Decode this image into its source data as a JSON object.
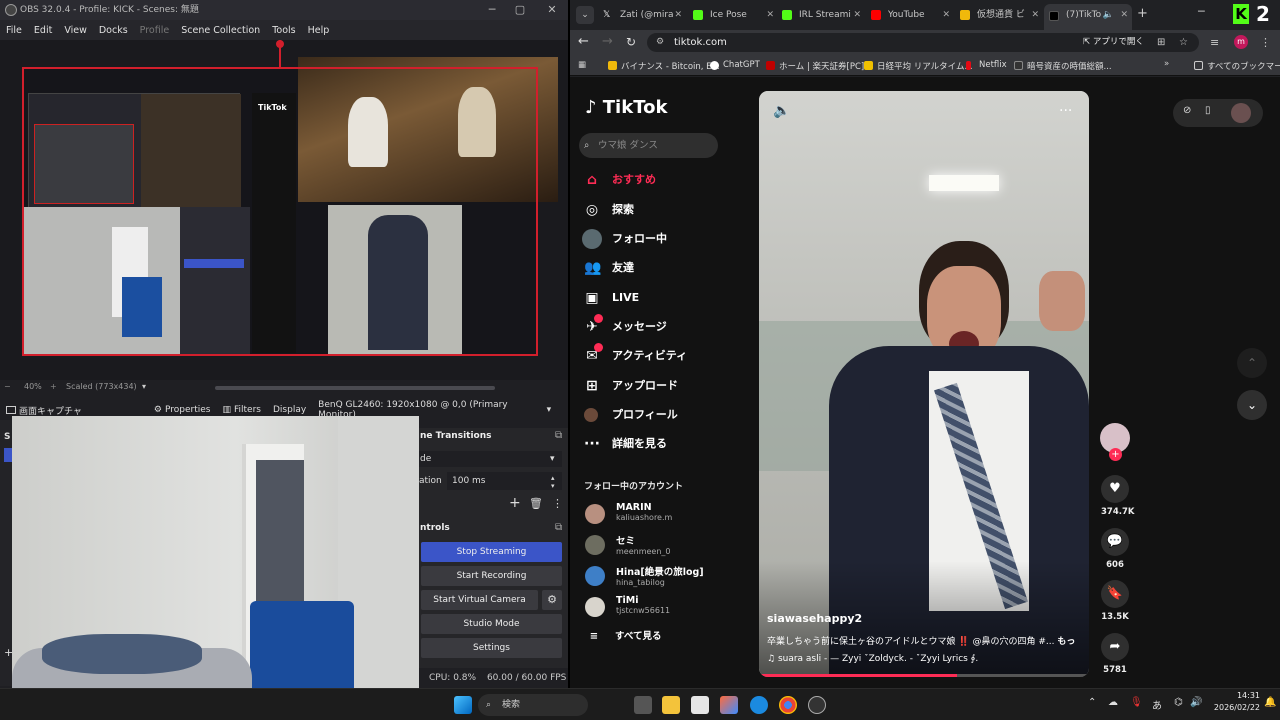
{
  "obs": {
    "title": "OBS 32.0.4 - Profile: KICK - Scenes: 無題",
    "menu": [
      "File",
      "Edit",
      "View",
      "Docks",
      "Profile",
      "Scene Collection",
      "Tools",
      "Help"
    ],
    "zoom": "40%",
    "scaled": "Scaled (773x434)",
    "source_name": "画面キャプチャ",
    "properties_label": "Properties",
    "filters_label": "Filters",
    "display_label": "Display",
    "display_value": "BenQ GL2460: 1920x1080 @ 0,0 (Primary Monitor)",
    "transitions_header": "ne Transitions",
    "transition_type": "de",
    "duration_label": "ation",
    "duration_value": "100 ms",
    "controls_header": "ntrols",
    "buttons": {
      "stop_streaming": "Stop Streaming",
      "start_recording": "Start Recording",
      "start_virtual_camera": "Start Virtual Camera",
      "studio_mode": "Studio Mode",
      "settings": "Settings"
    },
    "status": {
      "cpu": "CPU: 0.8%",
      "fps": "60.00 / 60.00 FPS"
    }
  },
  "chrome": {
    "tabs": [
      {
        "label": "Zati (@mira",
        "color": "#000000"
      },
      {
        "label": "Ice Pose",
        "color": "#53fc18"
      },
      {
        "label": "IRL Streami",
        "color": "#53fc18"
      },
      {
        "label": "YouTube",
        "color": "#ff0000"
      },
      {
        "label": "仮想通貨 ビ",
        "color": "#f0b90b"
      },
      {
        "label": "(7)TikTo",
        "color": "#000000"
      }
    ],
    "url": "tiktok.com",
    "open_app": "アプリで開く",
    "bookmarks": [
      {
        "label": "バイナンス - Bitcoin, E...",
        "color": "#f0b90b"
      },
      {
        "label": "ChatGPT",
        "color": "#ffffff"
      },
      {
        "label": "ホーム | 楽天証券[PC]",
        "color": "#bf0000"
      },
      {
        "label": "日経平均 リアルタイム...",
        "color": "#f0c000"
      },
      {
        "label": "Netflix",
        "color": "#e50914"
      },
      {
        "label": "暗号資産の時価総額...",
        "color": "#333333"
      }
    ],
    "all_bookmarks": "すべてのブックマーク"
  },
  "tiktok": {
    "logo": "TikTok",
    "search_placeholder": "ウマ娘 ダンス",
    "nav": [
      {
        "label": "おすすめ",
        "icon": "home-icon",
        "active": true
      },
      {
        "label": "探索",
        "icon": "compass-icon"
      },
      {
        "label": "フォロー中",
        "icon": "following-avatar"
      },
      {
        "label": "友達",
        "icon": "friends-icon"
      },
      {
        "label": "LIVE",
        "icon": "live-icon"
      },
      {
        "label": "メッセージ",
        "icon": "message-icon",
        "badge": "2"
      },
      {
        "label": "アクティビティ",
        "icon": "activity-icon",
        "badge": "8"
      },
      {
        "label": "アップロード",
        "icon": "upload-icon"
      },
      {
        "label": "プロフィール",
        "icon": "profile-icon"
      },
      {
        "label": "詳細を見る",
        "icon": "more-icon"
      }
    ],
    "following_header": "フォロー中のアカウント",
    "following": [
      {
        "name": "MARIN",
        "handle": "kaliuashore.m"
      },
      {
        "name": "セミ",
        "handle": "meenmeen_0"
      },
      {
        "name": "Hina[絶景の旅log]",
        "handle": "hina_tabilog"
      },
      {
        "name": "TiMi",
        "handle": "tjstcnw56611"
      }
    ],
    "see_all": "すべて見る",
    "video": {
      "author": "siawasehappy2",
      "caption": "卒業しちゃう前に保土ヶ谷のアイドルとウマ娘 ‼️ @鼻の穴の四角 #...",
      "more": "もっと見る",
      "music": "suara asli - — Zyyi ˇZoldyck. - ˇZyyi Lyrics ∮."
    },
    "actions": {
      "likes": "374.7K",
      "comments": "606",
      "saves": "13.5K",
      "shares": "5781"
    }
  },
  "taskbar": {
    "search": "検索",
    "time": "14:31",
    "date": "2026/02/22",
    "ime": "あ"
  }
}
